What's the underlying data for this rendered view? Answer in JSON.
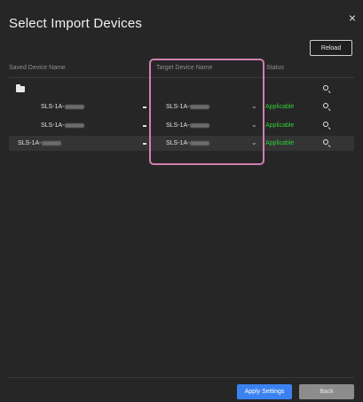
{
  "dialog": {
    "title": "Select Import Devices",
    "close_symbol": "×",
    "reload_label": "Reload"
  },
  "columns": {
    "saved": "Saved Device Name",
    "target": "Target Device Name",
    "status": "Status"
  },
  "rows": [
    {
      "saved": "SLS-1A-",
      "target": "SLS-1A-",
      "status": "Applicable"
    },
    {
      "saved": "SLS-1A-",
      "target": "SLS-1A-",
      "status": "Applicable"
    },
    {
      "saved": "SLS-1A-",
      "target": "SLS-1A-",
      "status": "Applicable"
    }
  ],
  "buttons": {
    "apply": "Apply Settings",
    "back": "Back"
  },
  "colors": {
    "applicable": "#2fcf3a",
    "highlight_border": "#d27fb0",
    "apply_button": "#3b82f0"
  },
  "icons": {
    "folder": "folder-icon",
    "search": "search-icon",
    "dropdown": "chevron-down-icon",
    "close": "close-icon"
  }
}
